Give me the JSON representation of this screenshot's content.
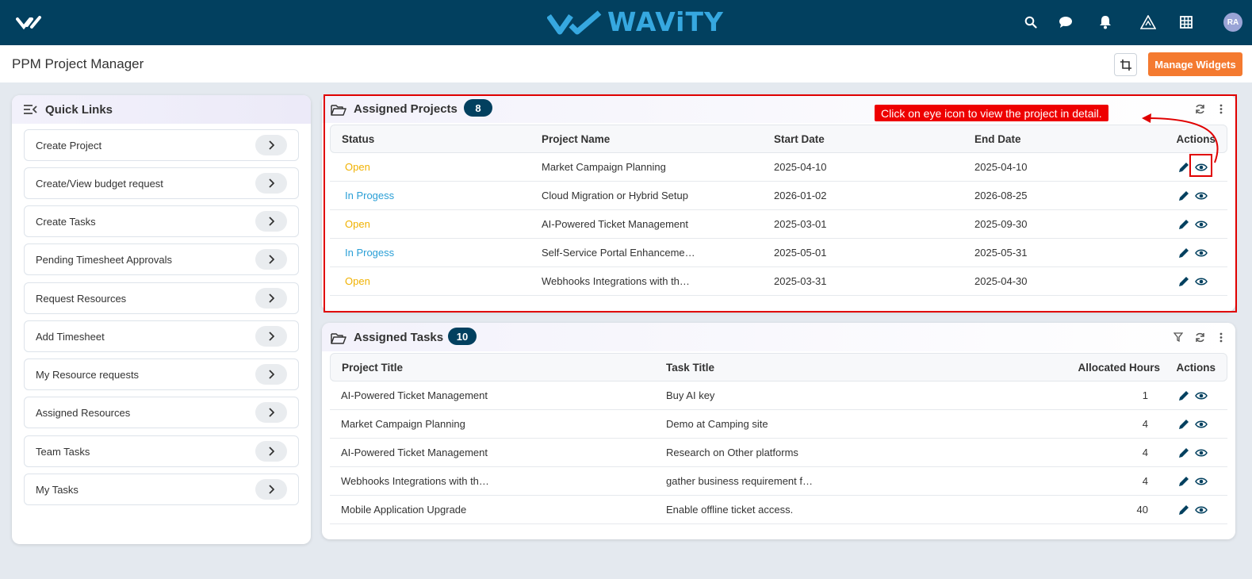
{
  "topbar": {
    "brand": "WAViTY",
    "avatar": "RA",
    "icons": [
      "search-icon",
      "chat-icon",
      "bell-icon",
      "warning-icon",
      "grid-icon"
    ]
  },
  "page": {
    "title": "PPM Project Manager",
    "manage_widgets": "Manage Widgets"
  },
  "quick_links": {
    "title": "Quick Links",
    "items": [
      "Create Project",
      "Create/View budget request",
      "Create Tasks",
      "Pending Timesheet Approvals",
      "Request Resources",
      "Add Timesheet",
      "My Resource requests",
      "Assigned Resources",
      "Team Tasks",
      "My Tasks"
    ]
  },
  "projects": {
    "title": "Assigned Projects",
    "count": "8",
    "callout": "Click on eye icon to view the project in detail.",
    "columns": [
      "Status",
      "Project Name",
      "Start Date",
      "End Date",
      "Actions"
    ],
    "rows": [
      {
        "status": "Open",
        "name": "Market Campaign Planning",
        "start": "2025-04-10",
        "end": "2025-04-10"
      },
      {
        "status": "In Progess",
        "name": "Cloud Migration or Hybrid Setup",
        "start": "2026-01-02",
        "end": "2026-08-25"
      },
      {
        "status": "Open",
        "name": "AI-Powered Ticket Management",
        "start": "2025-03-01",
        "end": "2025-09-30"
      },
      {
        "status": "In Progess",
        "name": "Self-Service Portal Enhanceme…",
        "start": "2025-05-01",
        "end": "2025-05-31"
      },
      {
        "status": "Open",
        "name": "Webhooks Integrations with th…",
        "start": "2025-03-31",
        "end": "2025-04-30"
      }
    ]
  },
  "tasks": {
    "title": "Assigned Tasks",
    "count": "10",
    "columns": [
      "Project Title",
      "Task Title",
      "Allocated Hours",
      "Actions"
    ],
    "rows": [
      {
        "project": "AI-Powered Ticket Management",
        "task": "Buy AI key",
        "hours": "1"
      },
      {
        "project": "Market Campaign Planning",
        "task": "Demo at Camping site",
        "hours": "4"
      },
      {
        "project": "AI-Powered Ticket Management",
        "task": "Research on Other platforms",
        "hours": "4"
      },
      {
        "project": "Webhooks Integrations with th…",
        "task": "gather business requirement f…",
        "hours": "4"
      },
      {
        "project": "Mobile Application Upgrade",
        "task": "Enable offline ticket access.",
        "hours": "40"
      }
    ]
  },
  "colors": {
    "topbar": "#02405f",
    "brand": "#36a8e0",
    "accent": "#f47a30",
    "open": "#f0b100",
    "in_progress": "#2a9fd6",
    "annotation": "#e00000"
  }
}
